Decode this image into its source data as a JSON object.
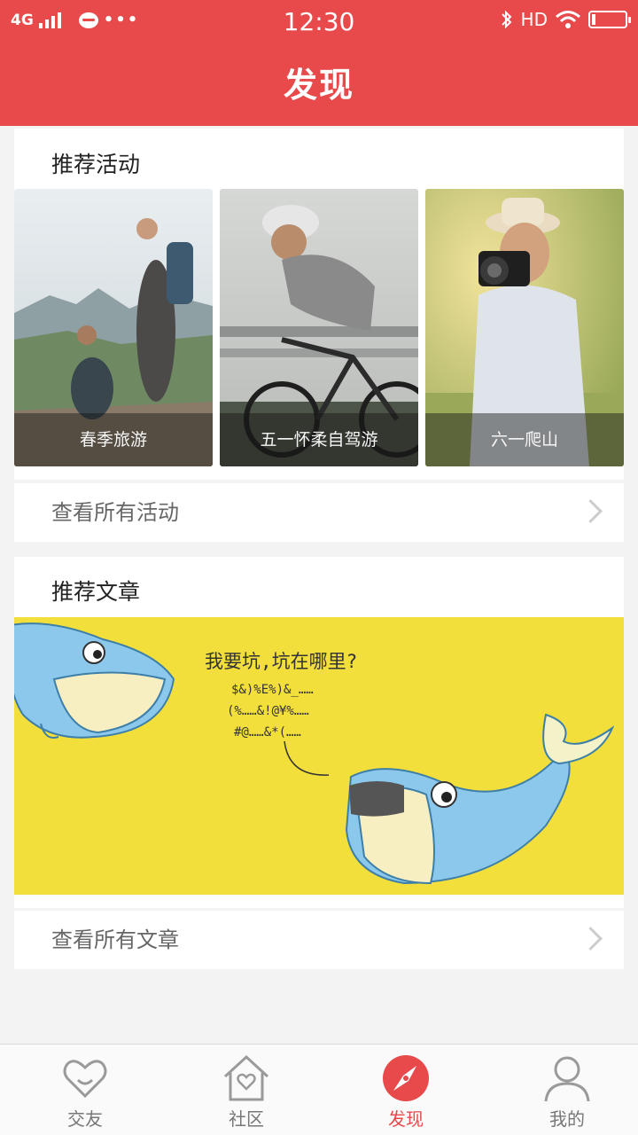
{
  "status_bar": {
    "network": "4G",
    "time": "12:30",
    "hd": "HD"
  },
  "header": {
    "title": "发现"
  },
  "activities": {
    "section_title": "推荐活动",
    "items": [
      {
        "caption": "春季旅游"
      },
      {
        "caption": "五一怀柔自驾游"
      },
      {
        "caption": "六一爬山"
      }
    ],
    "view_all": "查看所有活动"
  },
  "articles": {
    "section_title": "推荐文章",
    "banner_text": {
      "line1": "我要坑,坑在哪里?",
      "line2": "$&)%E%)&_……",
      "line3": "(%……&!@¥%……",
      "line4": "#@……&*(……"
    },
    "view_all": "查看所有文章"
  },
  "tabbar": {
    "tabs": [
      {
        "label": "交友",
        "icon": "heart-icon"
      },
      {
        "label": "社区",
        "icon": "home-heart-icon"
      },
      {
        "label": "发现",
        "icon": "compass-icon",
        "active": true
      },
      {
        "label": "我的",
        "icon": "user-icon"
      }
    ]
  },
  "colors": {
    "accent": "#e8494a",
    "banner_yellow": "#f3df3c"
  }
}
